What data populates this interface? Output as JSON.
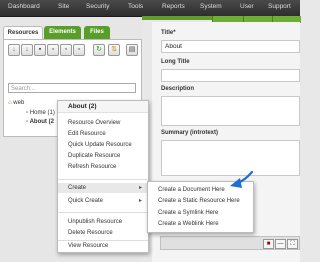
{
  "topnav": {
    "items": [
      "Dashboard",
      "Site",
      "Security",
      "Tools",
      "Reports",
      "System",
      "User",
      "Support"
    ]
  },
  "left": {
    "tabs": [
      "Resources",
      "Elements",
      "Files"
    ],
    "search_placeholder": "Search...",
    "tree": {
      "root": "web",
      "children": [
        "Home (1)",
        "About (2"
      ]
    }
  },
  "right": {
    "title_label": "Title*",
    "title_value": "About",
    "longtitle_label": "Long Title",
    "description_label": "Description",
    "summary_label": "Summary (introtext)"
  },
  "context_menu": {
    "header": "About (2)",
    "items": [
      "Resource Overview",
      "Edit Resource",
      "Quick Update Resource",
      "Duplicate Resource",
      "Refresh Resource",
      "Create",
      "Quick Create",
      "Unpublish Resource",
      "Delete Resource",
      "View Resource"
    ],
    "submenu_arrow": "▸"
  },
  "submenu": {
    "items": [
      "Create a Document Here",
      "Create a Static Resource Here",
      "Create a Symlink Here",
      "Create a Weblink Here"
    ]
  },
  "colors": {
    "accent_green": "#5a9e2a",
    "annotation_arrow": "#1e6fd6"
  },
  "icons": [
    "new-document-icon",
    "new-weblink-icon",
    "new-symlink-icon",
    "new-static-icon",
    "new-document-alt-icon",
    "new-file-icon",
    "refresh-icon",
    "sort-icon",
    "purge-icon"
  ]
}
